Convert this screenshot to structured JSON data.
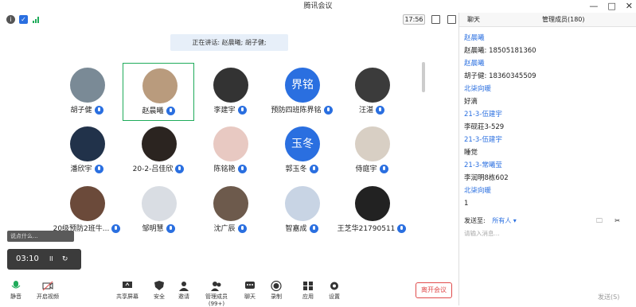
{
  "window": {
    "title": "腾讯会议",
    "minimize": "—",
    "maximize": "□",
    "close": "✕"
  },
  "toolbar": {
    "time": "17:56"
  },
  "speaking": {
    "text": "正在讲话: 赵晨曦; 胡子健;"
  },
  "participants": [
    {
      "name": "胡子健"
    },
    {
      "name": "赵晨曦"
    },
    {
      "name": "李建宇"
    },
    {
      "name": "预防四班陈界铭",
      "avatar_text": "界铭"
    },
    {
      "name": "汪湛"
    },
    {
      "name": "潘欣宇"
    },
    {
      "name": "20-2-吕佳欣"
    },
    {
      "name": "陈铭艳"
    },
    {
      "name": "郭玉冬",
      "avatar_text": "玉冬"
    },
    {
      "name": "侍庭宇"
    },
    {
      "name": "20级预防2班牛..."
    },
    {
      "name": "邹明慧"
    },
    {
      "name": "沈广辰"
    },
    {
      "name": "智嘉成"
    },
    {
      "name": "王芝华21790511"
    }
  ],
  "float": {
    "hint": "说点什么...",
    "timer": "03:10",
    "pause": "II",
    "close": "✕"
  },
  "bottom": {
    "mute": "静音",
    "video": "开启视频",
    "share": "共享屏幕",
    "security": "安全",
    "invite": "邀请",
    "members": "管理成员(99+)",
    "chat": "聊天",
    "record": "录制",
    "apps": "应用",
    "settings": "设置",
    "leave": "离开会议"
  },
  "right": {
    "tab_chat": "聊天",
    "tab_members": "管理成员(180)",
    "messages": [
      {
        "text": "赵晨曦",
        "kind": "name"
      },
      {
        "text": "赵晨曦: 18505181360",
        "kind": "body"
      },
      {
        "text": "赵晨曦",
        "kind": "name"
      },
      {
        "text": "胡子健: 18360345509",
        "kind": "body"
      },
      {
        "text": "北柒向暖",
        "kind": "name"
      },
      {
        "text": "好滴",
        "kind": "body"
      },
      {
        "text": "21-3-伍建宇",
        "kind": "name"
      },
      {
        "text": "李砚莊3-529",
        "kind": "body"
      },
      {
        "text": "21-3-伍建宇",
        "kind": "name"
      },
      {
        "text": "睡觉",
        "kind": "body"
      },
      {
        "text": "21-3-常曦莹",
        "kind": "name"
      },
      {
        "text": "李润明8栋602",
        "kind": "body"
      },
      {
        "text": "北柒向暖",
        "kind": "name"
      },
      {
        "text": "1",
        "kind": "body"
      }
    ],
    "send_to_label": "发送至:",
    "send_to_value": "所有人 ▾",
    "input_placeholder": "请输入消息...",
    "send_button": "发送(S)"
  }
}
